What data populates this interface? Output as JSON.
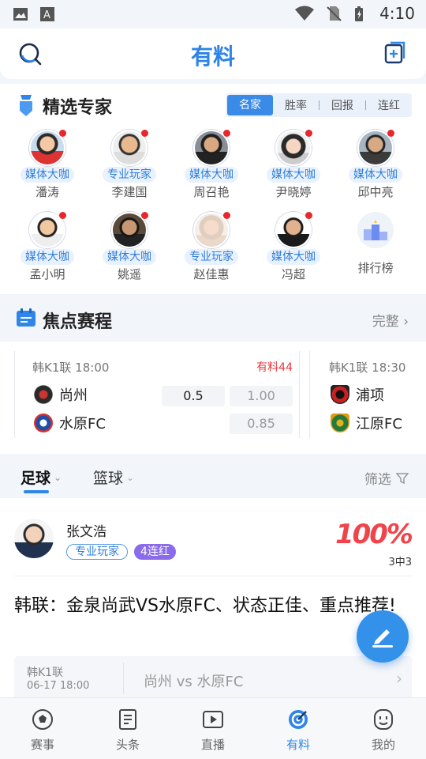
{
  "status_bar": {
    "time": "4:10"
  },
  "header": {
    "title": "有料"
  },
  "experts": {
    "title": "精选专家",
    "segments": [
      "名家",
      "胜率",
      "回报",
      "连红"
    ],
    "items": [
      {
        "tag": "媒体大咖",
        "name": "潘涛"
      },
      {
        "tag": "专业玩家",
        "name": "李建国"
      },
      {
        "tag": "媒体大咖",
        "name": "周召艳"
      },
      {
        "tag": "媒体大咖",
        "name": "尹晓婷"
      },
      {
        "tag": "媒体大咖",
        "name": "邱中亮"
      },
      {
        "tag": "媒体大咖",
        "name": "孟小明"
      },
      {
        "tag": "媒体大咖",
        "name": "姚遥"
      },
      {
        "tag": "专业玩家",
        "name": "赵佳惠"
      },
      {
        "tag": "媒体大咖",
        "name": "冯超"
      }
    ],
    "ranking_label": "排行榜"
  },
  "focus": {
    "title": "焦点赛程",
    "more": "完整",
    "match1": {
      "league": "韩K1联",
      "time": "18:00",
      "youliao": "有料44",
      "home": "尚州",
      "away": "水原FC",
      "handicap": "0.5",
      "odds_home": "1.00",
      "odds_away": "0.85"
    },
    "match2": {
      "league": "韩K1联",
      "time": "18:30",
      "home": "浦项",
      "away": "江原FC"
    }
  },
  "sport_tabs": {
    "football": "足球",
    "basketball": "篮球",
    "filter": "筛选"
  },
  "post": {
    "author": "张文浩",
    "tag": "专业玩家",
    "streak": "4连红",
    "rate": "100%",
    "record": "3中3",
    "headline": "韩联：金泉尚武VS水原FC、状态正佳、重点推荐!",
    "match_league": "韩K1联",
    "match_time": "06-17 18:00",
    "match_vs": "尚州 vs 水原FC"
  },
  "bottom_nav": [
    "赛事",
    "头条",
    "直播",
    "有料",
    "我的"
  ]
}
